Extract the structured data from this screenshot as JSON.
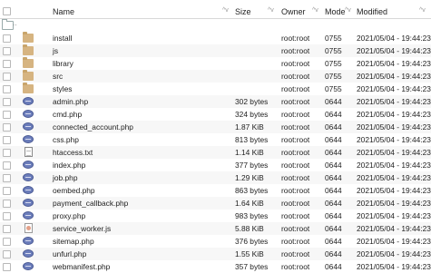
{
  "columns": {
    "name": "Name",
    "size": "Size",
    "owner": "Owner",
    "mode": "Mode",
    "modified": "Modified"
  },
  "sort_indicator": "^v",
  "parent_label": "..",
  "files": [
    {
      "name": "install",
      "size": "",
      "owner": "root:root",
      "mode": "0755",
      "modified": "2021/05/04 - 19:44:23",
      "icon": "folder-icon"
    },
    {
      "name": "js",
      "size": "",
      "owner": "root:root",
      "mode": "0755",
      "modified": "2021/05/04 - 19:44:23",
      "icon": "folder-icon"
    },
    {
      "name": "library",
      "size": "",
      "owner": "root:root",
      "mode": "0755",
      "modified": "2021/05/04 - 19:44:23",
      "icon": "folder-icon"
    },
    {
      "name": "src",
      "size": "",
      "owner": "root:root",
      "mode": "0755",
      "modified": "2021/05/04 - 19:44:23",
      "icon": "folder-icon"
    },
    {
      "name": "styles",
      "size": "",
      "owner": "root:root",
      "mode": "0755",
      "modified": "2021/05/04 - 19:44:23",
      "icon": "folder-icon"
    },
    {
      "name": "admin.php",
      "size": "302 bytes",
      "owner": "root:root",
      "mode": "0644",
      "modified": "2021/05/04 - 19:44:23",
      "icon": "php-icon"
    },
    {
      "name": "cmd.php",
      "size": "324 bytes",
      "owner": "root:root",
      "mode": "0644",
      "modified": "2021/05/04 - 19:44:23",
      "icon": "php-icon"
    },
    {
      "name": "connected_account.php",
      "size": "1.87 KiB",
      "owner": "root:root",
      "mode": "0644",
      "modified": "2021/05/04 - 19:44:23",
      "icon": "php-icon"
    },
    {
      "name": "css.php",
      "size": "813 bytes",
      "owner": "root:root",
      "mode": "0644",
      "modified": "2021/05/04 - 19:44:23",
      "icon": "php-icon"
    },
    {
      "name": "htaccess.txt",
      "size": "1.14 KiB",
      "owner": "root:root",
      "mode": "0644",
      "modified": "2021/05/04 - 19:44:23",
      "icon": "text-file-icon"
    },
    {
      "name": "index.php",
      "size": "377 bytes",
      "owner": "root:root",
      "mode": "0644",
      "modified": "2021/05/04 - 19:44:23",
      "icon": "php-icon"
    },
    {
      "name": "job.php",
      "size": "1.29 KiB",
      "owner": "root:root",
      "mode": "0644",
      "modified": "2021/05/04 - 19:44:23",
      "icon": "php-icon"
    },
    {
      "name": "oembed.php",
      "size": "863 bytes",
      "owner": "root:root",
      "mode": "0644",
      "modified": "2021/05/04 - 19:44:23",
      "icon": "php-icon"
    },
    {
      "name": "payment_callback.php",
      "size": "1.64 KiB",
      "owner": "root:root",
      "mode": "0644",
      "modified": "2021/05/04 - 19:44:23",
      "icon": "php-icon"
    },
    {
      "name": "proxy.php",
      "size": "983 bytes",
      "owner": "root:root",
      "mode": "0644",
      "modified": "2021/05/04 - 19:44:23",
      "icon": "php-icon"
    },
    {
      "name": "service_worker.js",
      "size": "5.88 KiB",
      "owner": "root:root",
      "mode": "0644",
      "modified": "2021/05/04 - 19:44:23",
      "icon": "js-file-icon"
    },
    {
      "name": "sitemap.php",
      "size": "376 bytes",
      "owner": "root:root",
      "mode": "0644",
      "modified": "2021/05/04 - 19:44:23",
      "icon": "php-icon"
    },
    {
      "name": "unfurl.php",
      "size": "1.55 KiB",
      "owner": "root:root",
      "mode": "0644",
      "modified": "2021/05/04 - 19:44:23",
      "icon": "php-icon"
    },
    {
      "name": "webmanifest.php",
      "size": "357 bytes",
      "owner": "root:root",
      "mode": "0644",
      "modified": "2021/05/04 - 19:44:23",
      "icon": "php-icon"
    }
  ]
}
